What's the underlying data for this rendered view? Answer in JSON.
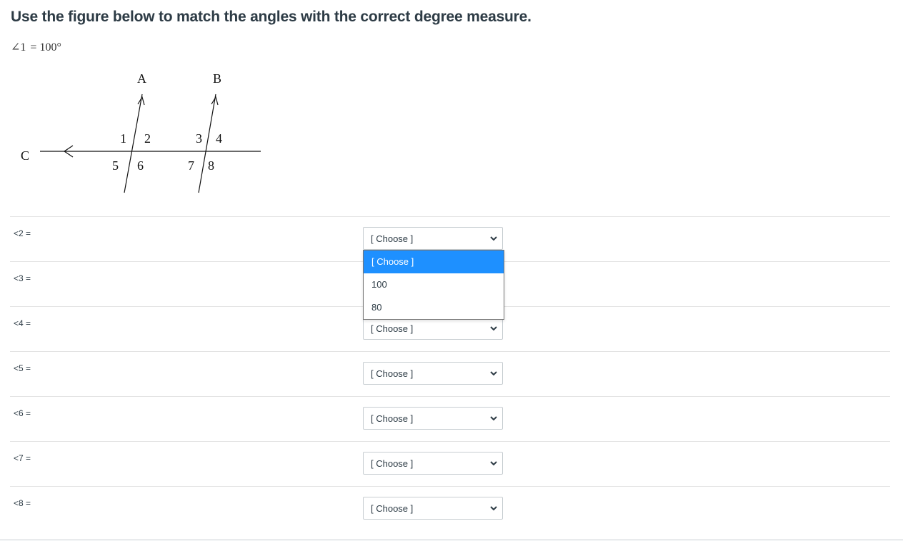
{
  "question": {
    "prompt": "Use the figure below to match the angles with the correct degree measure.",
    "given_angle": "∠1",
    "given_equals": "=",
    "given_value": "100°"
  },
  "figure": {
    "line_labels": {
      "a": "A",
      "b": "B",
      "c": "C"
    },
    "angle_labels": [
      "1",
      "2",
      "3",
      "4",
      "5",
      "6",
      "7",
      "8"
    ]
  },
  "rows": [
    {
      "label": "<2 =",
      "value": "[ Choose ]"
    },
    {
      "label": "<3 =",
      "value": ""
    },
    {
      "label": "<4 =",
      "value": "[ Choose ]"
    },
    {
      "label": "<5 =",
      "value": "[ Choose ]"
    },
    {
      "label": "<6 =",
      "value": "[ Choose ]"
    },
    {
      "label": "<7 =",
      "value": "[ Choose ]"
    },
    {
      "label": "<8 =",
      "value": "[ Choose ]"
    }
  ],
  "dropdown": {
    "options": [
      "[ Choose ]",
      "100",
      "80"
    ],
    "highlighted_index": 0,
    "highlight_color": "#1e90ff"
  }
}
